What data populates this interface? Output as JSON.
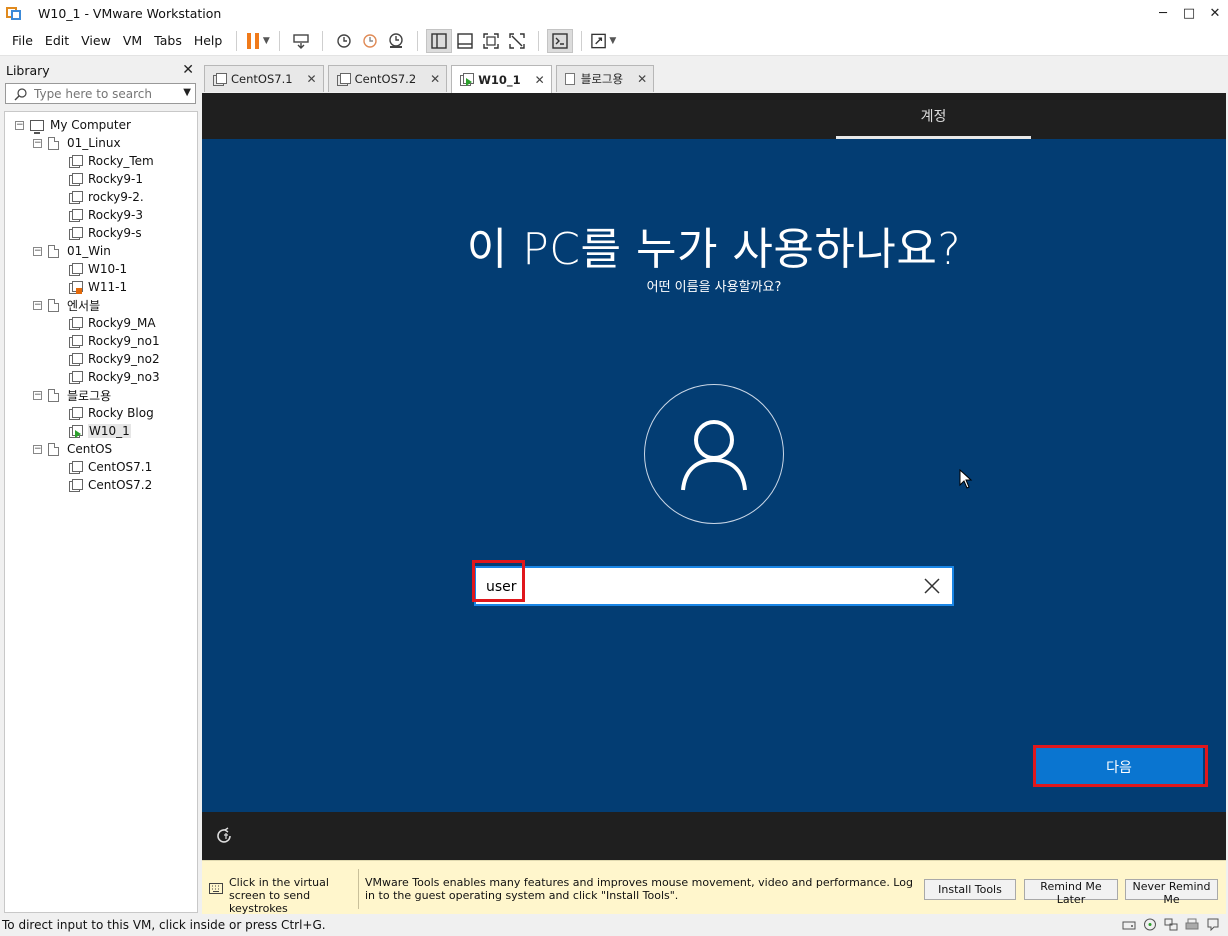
{
  "window": {
    "title": "W10_1 - VMware Workstation",
    "min": "─",
    "max": "□",
    "close": "✕"
  },
  "menu": [
    "File",
    "Edit",
    "View",
    "VM",
    "Tabs",
    "Help"
  ],
  "library": {
    "title": "Library",
    "close": "✕",
    "search_placeholder": "Type here to search",
    "tree": {
      "root": "My Computer",
      "groups": [
        {
          "name": "01_Linux",
          "items": [
            "Rocky_Tem",
            "Rocky9-1",
            "rocky9-2.",
            "Rocky9-3",
            "Rocky9-s"
          ]
        },
        {
          "name": "01_Win",
          "items": [
            "W10-1",
            "W11-1"
          ]
        },
        {
          "name": "엔서블",
          "items": [
            "Rocky9_MA",
            "Rocky9_no1",
            "Rocky9_no2",
            "Rocky9_no3"
          ]
        },
        {
          "name": "블로그용",
          "items": [
            "Rocky Blog",
            "W10_1"
          ]
        },
        {
          "name": "CentOS",
          "items": [
            "CentOS7.1",
            "CentOS7.2"
          ]
        }
      ]
    }
  },
  "tabs": [
    {
      "label": "CentOS7.1",
      "close": "✕"
    },
    {
      "label": "CentOS7.2",
      "close": "✕"
    },
    {
      "label": "W10_1",
      "close": "✕"
    },
    {
      "label": "블로그용",
      "close": "✕"
    }
  ],
  "vm": {
    "step_label": "계정",
    "title": "이 PC를 누가 사용하나요?",
    "subtitle": "어떤 이름을 사용할까요?",
    "name_value": "user",
    "next_label": "다음"
  },
  "tools_bar": {
    "hint_click": "Click in the virtual screen to send keystrokes",
    "hint_tools": "VMware Tools enables many features and improves mouse movement, video and performance. Log in to the guest operating system and click \"Install Tools\".",
    "install": "Install Tools",
    "remind": "Remind Me Later",
    "never": "Never Remind Me"
  },
  "status": {
    "text": "To direct input to this VM, click inside or press Ctrl+G."
  },
  "colors": {
    "vm_bg": "#033d73",
    "next_button": "#0a75d0",
    "highlight": "#e0171c",
    "pause": "#f07a1a"
  }
}
